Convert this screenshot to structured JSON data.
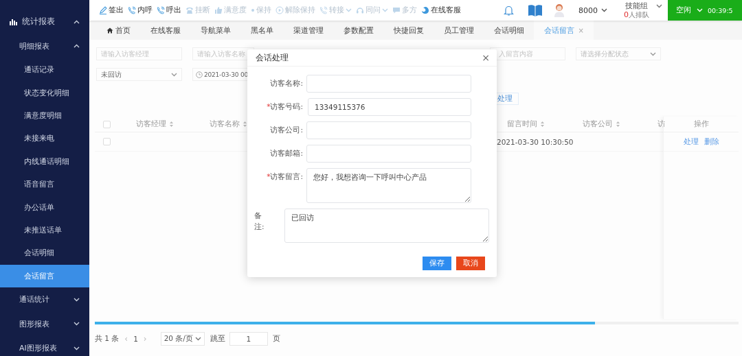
{
  "sidebar": {
    "items": [
      {
        "label": "统计报表",
        "selected": false,
        "expanded": true,
        "children": [
          {
            "label": "明细报表",
            "selected": false,
            "expanded": true,
            "children": [
              {
                "label": "通话记录",
                "selected": false
              },
              {
                "label": "状态变化明细",
                "selected": false
              },
              {
                "label": "满意度明细",
                "selected": false
              },
              {
                "label": "未接来电",
                "selected": false
              },
              {
                "label": "内线通话明细",
                "selected": false
              },
              {
                "label": "语音留言",
                "selected": false
              },
              {
                "label": "办公话单",
                "selected": false
              },
              {
                "label": "未推送话单",
                "selected": false
              },
              {
                "label": "会话明细",
                "selected": false
              },
              {
                "label": "会话留言",
                "selected": true
              }
            ]
          },
          {
            "label": "通话统计",
            "selected": false,
            "expanded": false
          },
          {
            "label": "图形报表",
            "selected": false,
            "expanded": false
          },
          {
            "label": "AI图形报表",
            "selected": false,
            "expanded": false
          }
        ]
      }
    ]
  },
  "toolbar": {
    "actions": [
      {
        "label": "签出",
        "disabled": false,
        "dropdown": false
      },
      {
        "label": "内呼",
        "disabled": false,
        "dropdown": false
      },
      {
        "label": "呼出",
        "disabled": false,
        "dropdown": false
      },
      {
        "label": "挂断",
        "disabled": true,
        "dropdown": false
      },
      {
        "label": "满意度",
        "disabled": true,
        "dropdown": false
      },
      {
        "label": "保持",
        "disabled": true,
        "dropdown": false
      },
      {
        "label": "解除保持",
        "disabled": true,
        "dropdown": false
      },
      {
        "label": "转接",
        "disabled": true,
        "dropdown": true
      },
      {
        "label": "同问",
        "disabled": true,
        "dropdown": true
      },
      {
        "label": "多方",
        "disabled": true,
        "dropdown": false
      },
      {
        "label": "在线客服",
        "disabled": false,
        "dropdown": false
      }
    ],
    "extension": "8000",
    "skill_group": {
      "label": "技能组",
      "queue_count": "0",
      "queue_text": "人排队"
    },
    "status": "空闲",
    "timer": "00:39:5"
  },
  "tabs": [
    {
      "label": "首页",
      "selected": false
    },
    {
      "label": "在线客服",
      "selected": false
    },
    {
      "label": "导航菜单",
      "selected": false
    },
    {
      "label": "黑名单",
      "selected": false
    },
    {
      "label": "渠道管理",
      "selected": false
    },
    {
      "label": "参数配置",
      "selected": false
    },
    {
      "label": "快捷回复",
      "selected": false
    },
    {
      "label": "员工管理",
      "selected": false
    },
    {
      "label": "会话明细",
      "selected": false
    },
    {
      "label": "会话留言",
      "selected": true,
      "close": "×"
    }
  ],
  "filters": [
    {
      "kind": "input",
      "placeholder": "请输入访客经理"
    },
    {
      "kind": "input",
      "placeholder": "请输入访客名称"
    },
    {
      "kind": "input",
      "placeholder": "入留言内容"
    },
    {
      "kind": "select",
      "placeholder": "请选择分配状态"
    },
    {
      "kind": "select",
      "value": "未回访"
    },
    {
      "kind": "date",
      "value": "2021-03-30 00"
    }
  ],
  "process_button": "处理",
  "table": {
    "header_checked": false,
    "columns": [
      {
        "label": "访客经理",
        "sortable": true
      },
      {
        "label": "访客名称",
        "sortable": true
      },
      {
        "label": "留言时间",
        "sortable": true
      },
      {
        "label": "访客公司",
        "sortable": true
      },
      {
        "label": "访",
        "sortable": false
      },
      {
        "label": "操作",
        "sortable": false
      }
    ],
    "rows": [
      {
        "checked": false,
        "message_time": "2021-03-30 10:30:50",
        "actions": [
          "处理",
          "删除"
        ]
      }
    ]
  },
  "pagination": {
    "total": "共 1 条",
    "prev": "‹",
    "page": "1",
    "next": "›",
    "page_size": "20 条/页",
    "jump_label": "跳至",
    "jump_value": "1",
    "page_unit": "页"
  },
  "dialog": {
    "title": "会话处理",
    "close": "×",
    "fields": [
      {
        "label": "访客名称:",
        "kind": "input"
      },
      {
        "label": "访客号码:",
        "required_mark": "*",
        "kind": "input",
        "value": "13349115376"
      },
      {
        "label": "访客公司:",
        "kind": "input"
      },
      {
        "label": "访客邮箱:",
        "kind": "input"
      },
      {
        "label": "访客留言:",
        "required_mark": "*",
        "kind": "textarea",
        "value": "您好，我想咨询一下呼叫中心产品"
      }
    ],
    "note": {
      "label": "备注:",
      "kind": "textarea",
      "value": "已回访"
    },
    "buttons": [
      {
        "label": "保存",
        "kind": "primary"
      },
      {
        "label": "取消",
        "kind": "danger"
      }
    ]
  }
}
